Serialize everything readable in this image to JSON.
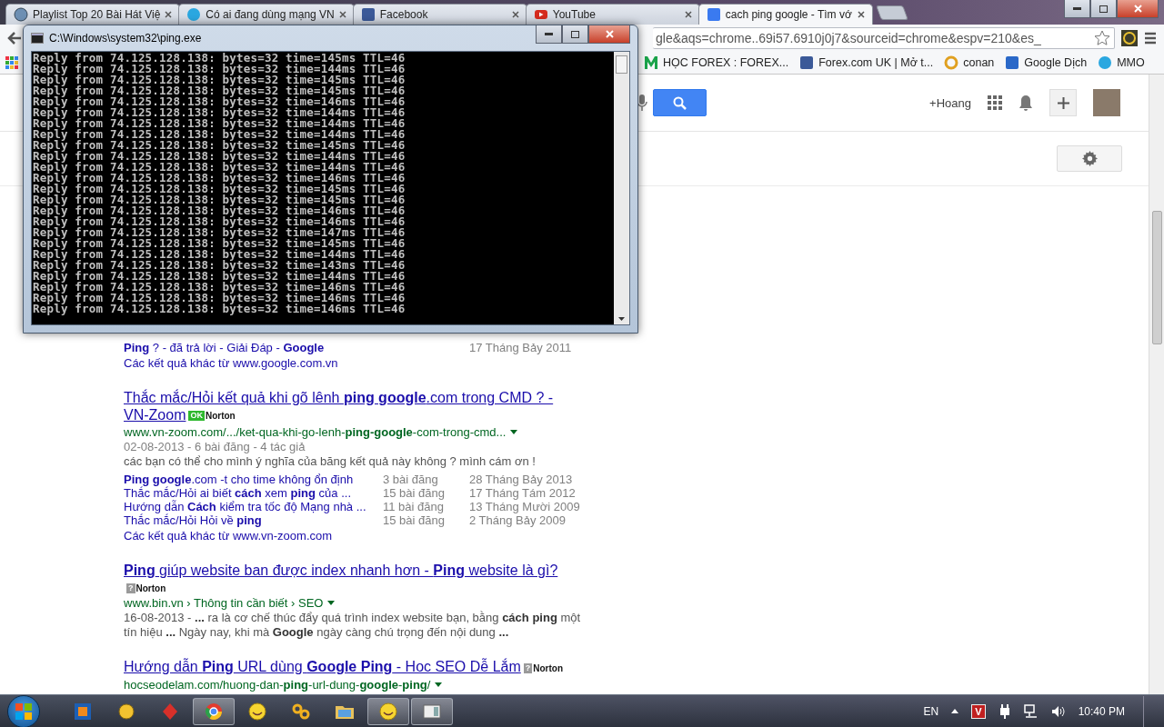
{
  "browser": {
    "tabs": [
      {
        "title": "Playlist Top 20 Bài Hát Việ",
        "kind": "disc",
        "selected": false
      },
      {
        "title": "Có ai đang dùng mạng VN",
        "kind": "chat",
        "selected": false
      },
      {
        "title": "Facebook",
        "kind": "social",
        "selected": false
      },
      {
        "title": "YouTube",
        "kind": "video",
        "selected": false
      },
      {
        "title": "cach ping google - Tìm vớ",
        "kind": "search",
        "selected": true
      }
    ],
    "address": "gle&aqs=chrome..69i57.6910j0j7&sourceid=chrome&espv=210&es_",
    "bookmarks": [
      {
        "label": "HỌC FOREX : FOREX...",
        "kind": "m"
      },
      {
        "label": "Forex.com UK | Mở t...",
        "kind": "social"
      },
      {
        "label": "conan",
        "kind": "ring"
      },
      {
        "label": "Google Dịch",
        "kind": "translate"
      },
      {
        "label": "MMO",
        "kind": "chat"
      }
    ],
    "account": "+Hoang",
    "results": [
      {
        "sitelinks": [
          {
            "title": "**Ping** ? - đã trả lời - Giải Đáp - **Google**",
            "date": "17 Tháng Bảy 2011"
          }
        ],
        "more": "Các kết quả khác từ www.google.com.vn"
      },
      {
        "title": "Thắc mắc/Hỏi kết quả khi gõ lênh **ping google**.com trong CMD ? - VN-Zoom",
        "badge": {
          "mark": "OK",
          "label": "Norton",
          "kind": "safe"
        },
        "url": "www.vn-zoom.com/.../ket-qua-khi-go-lenh-**ping-google**-com-trong-cmd...",
        "meta": "02-08-2013 - 6 bài đăng - 4 tác giả",
        "snippet": "các bạn có thể cho mình ý nghĩa của băng kết quả này không ? mình cám ơn !",
        "sitelinks": [
          {
            "title": "**Ping google**.com -t cho time không ổn định",
            "posts": "3 bài đăng",
            "date": "28 Tháng Bảy 2013"
          },
          {
            "title": "Thắc mắc/Hỏi ai biết **cách** xem **ping** của ...",
            "posts": "15 bài đăng",
            "date": "17 Tháng Tám 2012"
          },
          {
            "title": "Hướng dẫn **Cách** kiểm tra tốc độ Mạng nhà ...",
            "posts": "11 bài đăng",
            "date": "13 Tháng Mười 2009"
          },
          {
            "title": "Thắc mắc/Hỏi Hỏi về **ping**",
            "posts": "15 bài đăng",
            "date": "2 Tháng Bảy 2009"
          }
        ],
        "more": "Các kết quả khác từ www.vn-zoom.com"
      },
      {
        "title": "**Ping** giúp website ban được index nhanh hơn - **Ping** website là gì?",
        "tag_line": {
          "mark": "?",
          "label": "Norton",
          "kind": "unknown"
        },
        "url": "www.bin.vn › Thông tin cần biết › SEO",
        "snippet": "16-08-2013 - **...** ra là cơ chế thúc đẩy quá trình index website bạn, bằng **cách ping** một tín hiệu **...** Ngày nay, khi mà **Google** ngày càng chú trọng đến nội dung  **...**"
      },
      {
        "title": "Hướng dẫn **Ping** URL dùng **Google Ping** - Hoc SEO Dễ Lắm",
        "badge": {
          "mark": "?",
          "label": "Norton",
          "kind": "unknown"
        },
        "url": "hocseodelam.com/huong-dan-**ping**-url-dung-**google**-**ping**/"
      }
    ]
  },
  "console": {
    "title": "C:\\Windows\\system32\\ping.exe",
    "lines": [
      "Reply from 74.125.128.138: bytes=32 time=145ms TTL=46",
      "Reply from 74.125.128.138: bytes=32 time=144ms TTL=46",
      "Reply from 74.125.128.138: bytes=32 time=145ms TTL=46",
      "Reply from 74.125.128.138: bytes=32 time=145ms TTL=46",
      "Reply from 74.125.128.138: bytes=32 time=146ms TTL=46",
      "Reply from 74.125.128.138: bytes=32 time=144ms TTL=46",
      "Reply from 74.125.128.138: bytes=32 time=144ms TTL=46",
      "Reply from 74.125.128.138: bytes=32 time=144ms TTL=46",
      "Reply from 74.125.128.138: bytes=32 time=145ms TTL=46",
      "Reply from 74.125.128.138: bytes=32 time=144ms TTL=46",
      "Reply from 74.125.128.138: bytes=32 time=144ms TTL=46",
      "Reply from 74.125.128.138: bytes=32 time=146ms TTL=46",
      "Reply from 74.125.128.138: bytes=32 time=145ms TTL=46",
      "Reply from 74.125.128.138: bytes=32 time=145ms TTL=46",
      "Reply from 74.125.128.138: bytes=32 time=146ms TTL=46",
      "Reply from 74.125.128.138: bytes=32 time=146ms TTL=46",
      "Reply from 74.125.128.138: bytes=32 time=147ms TTL=46",
      "Reply from 74.125.128.138: bytes=32 time=145ms TTL=46",
      "Reply from 74.125.128.138: bytes=32 time=144ms TTL=46",
      "Reply from 74.125.128.138: bytes=32 time=143ms TTL=46",
      "Reply from 74.125.128.138: bytes=32 time=144ms TTL=46",
      "Reply from 74.125.128.138: bytes=32 time=146ms TTL=46",
      "Reply from 74.125.128.138: bytes=32 time=146ms TTL=46",
      "Reply from 74.125.128.138: bytes=32 time=146ms TTL=46"
    ]
  },
  "taskbar": {
    "items": [
      {
        "kind": "tile",
        "running": false
      },
      {
        "kind": "bird",
        "running": false
      },
      {
        "kind": "cards",
        "running": false
      },
      {
        "kind": "browser",
        "running": true
      },
      {
        "kind": "smiley",
        "running": false
      },
      {
        "kind": "chain",
        "running": false
      },
      {
        "kind": "folder",
        "running": false
      },
      {
        "kind": "smiley",
        "running": true
      },
      {
        "kind": "window",
        "running": true
      }
    ],
    "language": "EN",
    "tray_badge": "V",
    "time": "10:40 PM"
  }
}
